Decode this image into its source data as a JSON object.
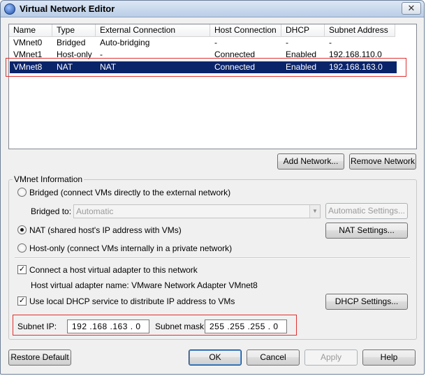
{
  "window": {
    "title": "Virtual Network Editor",
    "close_glyph": "✕"
  },
  "table": {
    "columns": [
      "Name",
      "Type",
      "External Connection",
      "Host Connection",
      "DHCP",
      "Subnet Address"
    ],
    "rows": [
      [
        "VMnet0",
        "Bridged",
        "Auto-bridging",
        "-",
        "-",
        "-"
      ],
      [
        "VMnet1",
        "Host-only",
        "-",
        "Connected",
        "Enabled",
        "192.168.110.0"
      ],
      [
        "VMnet8",
        "NAT",
        "NAT",
        "Connected",
        "Enabled",
        "192.168.163.0"
      ]
    ],
    "selected_row": 2
  },
  "buttons": {
    "add_network": "Add Network...",
    "remove_network": "Remove Network",
    "automatic_settings": "Automatic Settings...",
    "nat_settings": "NAT Settings...",
    "dhcp_settings": "DHCP Settings...",
    "restore_default": "Restore Default",
    "ok": "OK",
    "cancel": "Cancel",
    "apply": "Apply",
    "help": "Help"
  },
  "vmnet_info": {
    "group_label": "VMnet Information",
    "bridged_label": "Bridged (connect VMs directly to the external network)",
    "bridged_to_label": "Bridged to:",
    "bridged_to_value": "Automatic",
    "nat_label": "NAT (shared host's IP address with VMs)",
    "hostonly_label": "Host-only (connect VMs internally in a private network)",
    "selected_mode": "NAT",
    "connect_adapter_label": "Connect a host virtual adapter to this network",
    "connect_adapter_checked": true,
    "adapter_name_text": "Host virtual adapter name: VMware Network Adapter VMnet8",
    "dhcp_label": "Use local DHCP service to distribute IP address to VMs",
    "dhcp_checked": true,
    "check_glyph": "✓",
    "dropdown_glyph": "▼",
    "subnet_ip_label": "Subnet IP:",
    "subnet_ip_value": "192 .168 .163 . 0",
    "subnet_mask_label": "Subnet mask:",
    "subnet_mask_value": "255 .255 .255 . 0"
  },
  "colors": {
    "selection": "#0a246a",
    "highlight_box": "#e03030"
  }
}
